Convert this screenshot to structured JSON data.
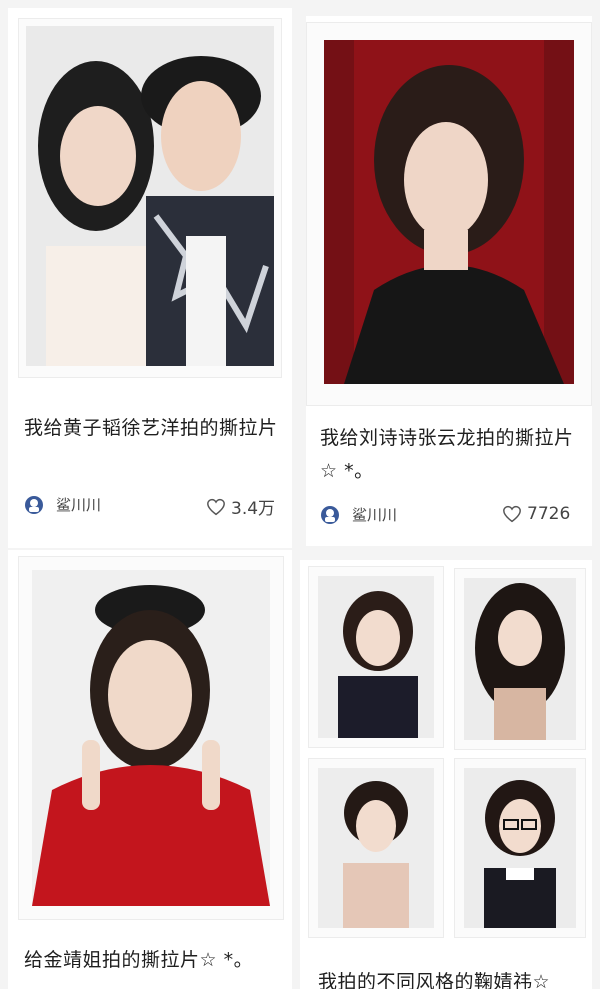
{
  "posts": [
    {
      "title": "我给黄子韬徐艺洋拍的撕拉片",
      "author": "鲨川川",
      "likes": "3.4万",
      "image_desc": "polaroid-couple"
    },
    {
      "title": "我给刘诗诗张云龙拍的撕拉片☆ *。",
      "author": "鲨川川",
      "likes": "7726",
      "image_desc": "polaroid-woman-red-curtain"
    },
    {
      "title": "给金靖姐拍的撕拉片☆ *。"
    },
    {
      "title": "我拍的不同风格的鞠婧祎☆"
    }
  ],
  "colors": {
    "background": "#f4f4f4",
    "card": "#ffffff",
    "text": "#1f1f1f",
    "meta_text": "#555555",
    "avatar_blue": "#3a5a9a"
  }
}
